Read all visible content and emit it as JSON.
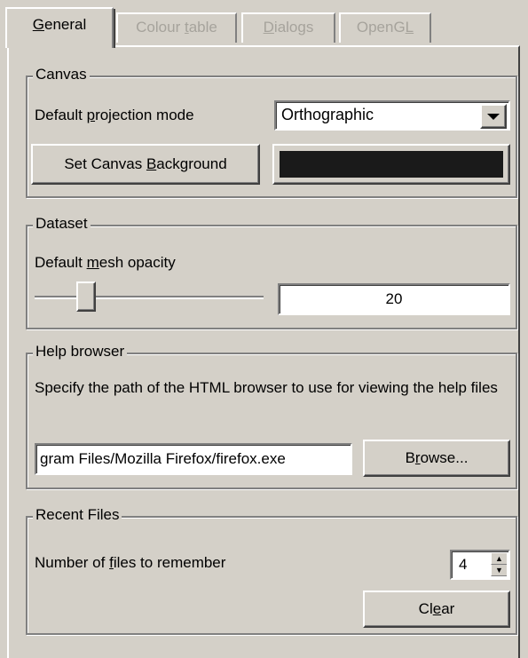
{
  "tabs": [
    {
      "label_pre": "",
      "label_key": "G",
      "label_post": "eneral",
      "active": true
    },
    {
      "label_pre": "Colour ",
      "label_key": "t",
      "label_post": "able",
      "active": false
    },
    {
      "label_pre": "",
      "label_key": "D",
      "label_post": "ialogs",
      "active": false
    },
    {
      "label_pre": "OpenG",
      "label_key": "L",
      "label_post": "",
      "active": false
    }
  ],
  "canvas": {
    "legend": "Canvas",
    "projection_label_pre": "Default ",
    "projection_label_key": "p",
    "projection_label_post": "rojection mode",
    "projection_value": "Orthographic",
    "bg_button_pre": "Set Canvas ",
    "bg_button_key": "B",
    "bg_button_post": "ackground",
    "bg_color": "#1a1a1a"
  },
  "dataset": {
    "legend": "Dataset",
    "opacity_label_pre": "Default ",
    "opacity_label_key": "m",
    "opacity_label_post": "esh opacity",
    "opacity_value": "20",
    "slider_fraction": 0.2
  },
  "help": {
    "legend": "Help browser",
    "description": "Specify the path of the HTML browser to use for viewing the help files",
    "path_value": "gram Files/Mozilla Firefox/firefox.exe",
    "browse_pre": "B",
    "browse_key": "r",
    "browse_post": "owse..."
  },
  "recent": {
    "legend": "Recent Files",
    "count_label_pre": "Number of ",
    "count_label_key": "f",
    "count_label_post": "iles to remember",
    "count_value": "4",
    "clear_pre": "Cl",
    "clear_key": "e",
    "clear_post": "ar"
  }
}
